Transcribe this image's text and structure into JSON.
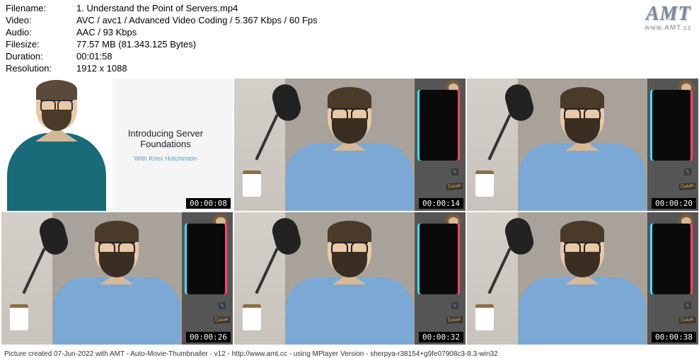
{
  "info": {
    "labels": {
      "filename": "Filename:",
      "video": "Video:",
      "audio": "Audio:",
      "filesize": "Filesize:",
      "duration": "Duration:",
      "resolution": "Resolution:"
    },
    "filename": "1. Understand the Point of Servers.mp4",
    "video": "AVC / avc1 / Advanced Video Coding / 5.367 Kbps / 60 Fps",
    "audio": "AAC / 93 Kbps",
    "filesize": "77.57 MB (81.343.125 Bytes)",
    "duration": "00:01:58",
    "resolution": "1912 x 1088"
  },
  "logo": {
    "main": "AMT",
    "sub": "www.AMT.cc"
  },
  "intro": {
    "title": "Introducing Server Foundations",
    "subtitle": "With Knox Hutchinson"
  },
  "scene_labels": {
    "data": "DataK",
    "twitter": "𝕏"
  },
  "thumbnails": [
    {
      "ts": "00:00:08"
    },
    {
      "ts": "00:00:14"
    },
    {
      "ts": "00:00:20"
    },
    {
      "ts": "00:00:26"
    },
    {
      "ts": "00:00:32"
    },
    {
      "ts": "00:00:38"
    }
  ],
  "footer": "Picture created 07-Jun-2022 with AMT - Auto-Movie-Thumbnailer - v12 - http://www.amt.cc - using MPlayer Version - sherpya-r38154+g9fe07908c3-8.3-win32"
}
